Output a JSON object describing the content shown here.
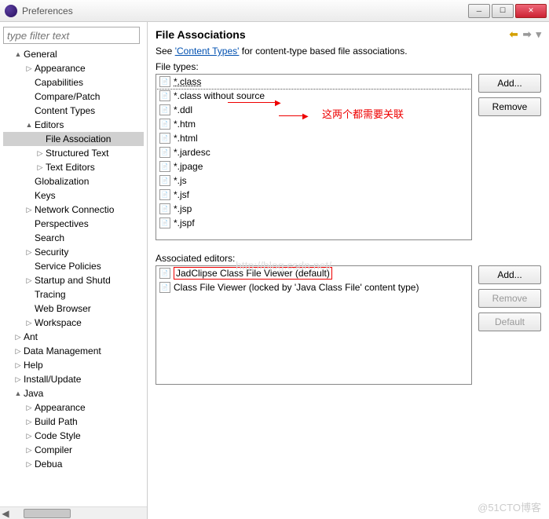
{
  "window": {
    "title": "Preferences"
  },
  "sidebar": {
    "filter_placeholder": "type filter text",
    "items": [
      {
        "label": "General",
        "depth": 1,
        "tw": "▲"
      },
      {
        "label": "Appearance",
        "depth": 2,
        "tw": "▷"
      },
      {
        "label": "Capabilities",
        "depth": 2,
        "tw": ""
      },
      {
        "label": "Compare/Patch",
        "depth": 2,
        "tw": ""
      },
      {
        "label": "Content Types",
        "depth": 2,
        "tw": ""
      },
      {
        "label": "Editors",
        "depth": 2,
        "tw": "▲"
      },
      {
        "label": "File Association",
        "depth": 3,
        "tw": "",
        "sel": true
      },
      {
        "label": "Structured Text",
        "depth": 3,
        "tw": "▷"
      },
      {
        "label": "Text Editors",
        "depth": 3,
        "tw": "▷"
      },
      {
        "label": "Globalization",
        "depth": 2,
        "tw": ""
      },
      {
        "label": "Keys",
        "depth": 2,
        "tw": ""
      },
      {
        "label": "Network Connectio",
        "depth": 2,
        "tw": "▷"
      },
      {
        "label": "Perspectives",
        "depth": 2,
        "tw": ""
      },
      {
        "label": "Search",
        "depth": 2,
        "tw": ""
      },
      {
        "label": "Security",
        "depth": 2,
        "tw": "▷"
      },
      {
        "label": "Service Policies",
        "depth": 2,
        "tw": ""
      },
      {
        "label": "Startup and Shutd",
        "depth": 2,
        "tw": "▷"
      },
      {
        "label": "Tracing",
        "depth": 2,
        "tw": ""
      },
      {
        "label": "Web Browser",
        "depth": 2,
        "tw": ""
      },
      {
        "label": "Workspace",
        "depth": 2,
        "tw": "▷"
      },
      {
        "label": "Ant",
        "depth": 1,
        "tw": "▷"
      },
      {
        "label": "Data Management",
        "depth": 1,
        "tw": "▷"
      },
      {
        "label": "Help",
        "depth": 1,
        "tw": "▷"
      },
      {
        "label": "Install/Update",
        "depth": 1,
        "tw": "▷"
      },
      {
        "label": "Java",
        "depth": 1,
        "tw": "▲"
      },
      {
        "label": "Appearance",
        "depth": 2,
        "tw": "▷"
      },
      {
        "label": "Build Path",
        "depth": 2,
        "tw": "▷"
      },
      {
        "label": "Code Style",
        "depth": 2,
        "tw": "▷"
      },
      {
        "label": "Compiler",
        "depth": 2,
        "tw": "▷"
      },
      {
        "label": "Debua",
        "depth": 2,
        "tw": "▷"
      }
    ]
  },
  "content": {
    "title": "File Associations",
    "desc_prefix": "See ",
    "desc_link": "'Content Types'",
    "desc_suffix": " for content-type based file associations.",
    "file_types_label": "File types:",
    "file_types": [
      "*.class",
      "*.class without source",
      "*.ddl",
      "*.htm",
      "*.html",
      "*.jardesc",
      "*.jpage",
      "*.js",
      "*.jsf",
      "*.jsp",
      "*.jspf"
    ],
    "assoc_label": "Associated editors:",
    "assoc_items": [
      "JadClipse Class File Viewer (default)",
      "Class File Viewer (locked by 'Java Class File' content type)"
    ],
    "buttons": {
      "add": "Add...",
      "remove": "Remove",
      "default": "Default"
    },
    "annotation": "这两个都需要关联"
  },
  "watermark": "@51CTO博客",
  "watermark2": "http://blog.csdn.net/"
}
